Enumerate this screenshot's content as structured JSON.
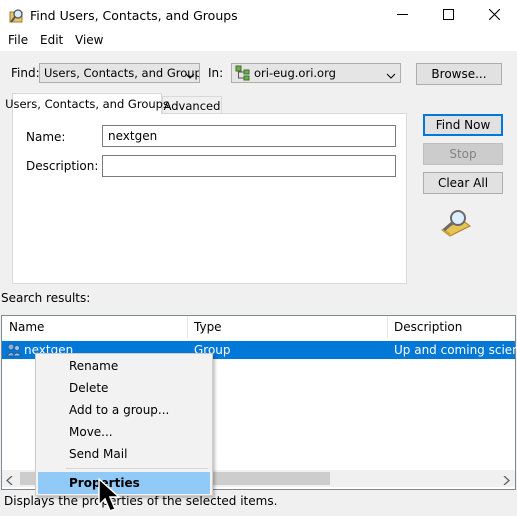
{
  "window": {
    "title": "Find Users, Contacts, and Groups",
    "minimize_glyph": "—",
    "maximize_glyph": "☐",
    "close_glyph": "✕"
  },
  "menubar": {
    "items": [
      "File",
      "Edit",
      "View"
    ]
  },
  "find": {
    "label": "Find:",
    "value": "Users, Contacts, and Groups",
    "in_label": "In:",
    "in_value": "ori-eug.ori.org",
    "browse_label": "Browse..."
  },
  "tabs": [
    {
      "label": "Users, Contacts, and Groups",
      "active": true
    },
    {
      "label": "Advanced",
      "active": false
    }
  ],
  "form": {
    "name_label": "Name:",
    "name_value": "nextgen",
    "description_label": "Description:",
    "description_value": ""
  },
  "buttons": {
    "find_now": "Find Now",
    "stop": "Stop",
    "clear_all": "Clear All"
  },
  "results": {
    "label": "Search results:",
    "columns": [
      "Name",
      "Type",
      "Description"
    ],
    "rows": [
      {
        "name": "nextgen",
        "type": "Group",
        "description": "Up and coming scienti"
      }
    ]
  },
  "context_menu": {
    "items": [
      "Rename",
      "Delete",
      "Add to a group...",
      "Move...",
      "Send Mail"
    ],
    "default_item": "Properties"
  },
  "status": {
    "text": "Displays the properties of the selected items."
  },
  "colors": {
    "selection": "#0078d7",
    "default_button_border": "#0078d7"
  },
  "icons": {
    "app": "search-directory-icon",
    "domain": "domain-tree-icon",
    "search_animation": "magnifier-folder-icon",
    "row": "group-icon"
  }
}
